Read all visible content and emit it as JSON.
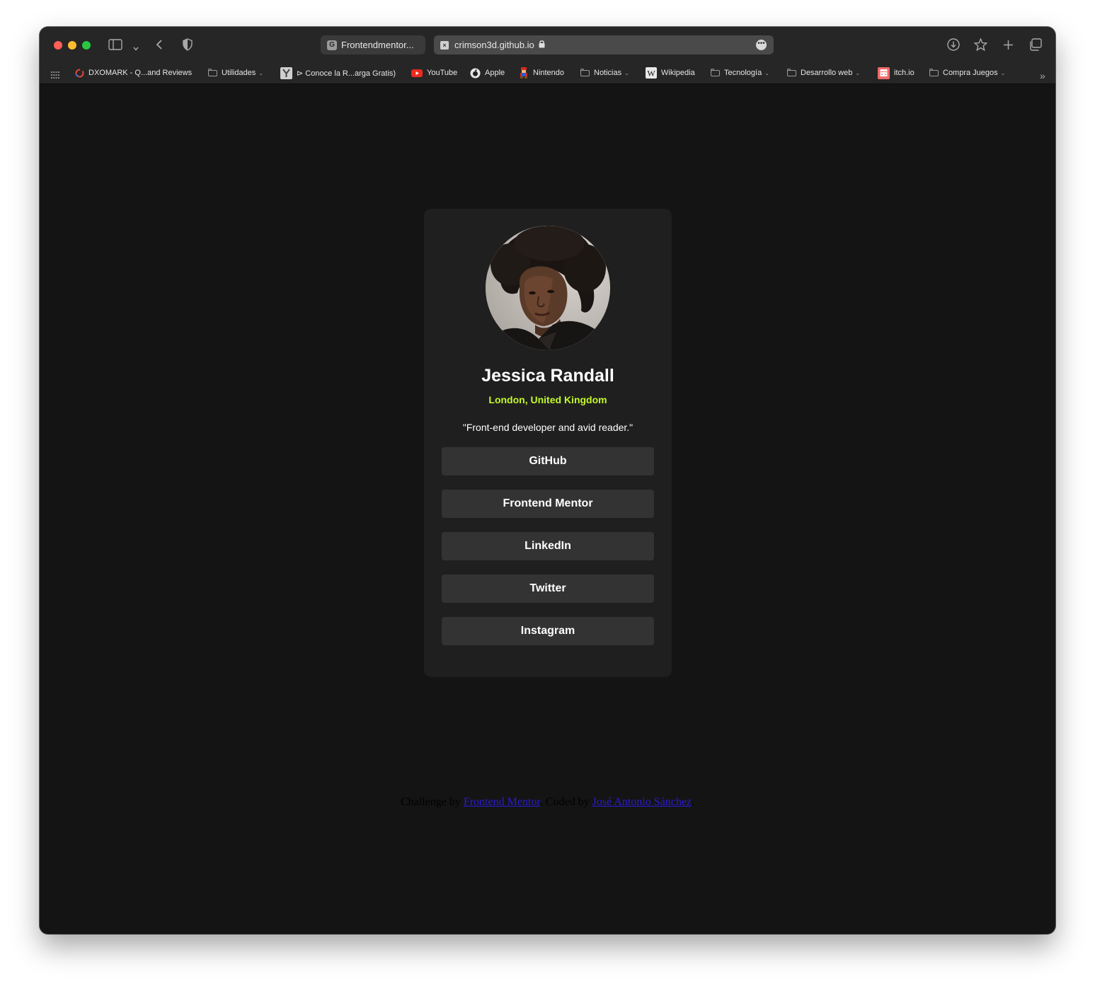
{
  "browser": {
    "tabs": [
      {
        "label": "Frontendmentor...",
        "favicon": "G"
      },
      {
        "label": "crimson3d.github.io"
      }
    ],
    "bookmarks": [
      {
        "label": "DXOMARK - Q...and Reviews",
        "icon": "dxomark-icon"
      },
      {
        "label": "Utilidades",
        "icon": "folder-icon",
        "folder": true
      },
      {
        "label": "⊳ Conoce la R...arga Gratis)",
        "icon": "bookmark-favicon-icon"
      },
      {
        "label": "YouTube",
        "icon": "youtube-icon"
      },
      {
        "label": "Apple",
        "icon": "apple-icon"
      },
      {
        "label": "Nintendo",
        "icon": "nintendo-icon"
      },
      {
        "label": "Noticias",
        "icon": "folder-icon",
        "folder": true
      },
      {
        "label": "Wikipedia",
        "icon": "wikipedia-icon"
      },
      {
        "label": "Tecnología",
        "icon": "folder-icon",
        "folder": true
      },
      {
        "label": "Desarrollo web",
        "icon": "folder-icon",
        "folder": true
      },
      {
        "label": "itch.io",
        "icon": "itchio-icon"
      },
      {
        "label": "Compra Juegos",
        "icon": "folder-icon",
        "folder": true
      }
    ]
  },
  "profile": {
    "name": "Jessica Randall",
    "location": "London, United Kingdom",
    "bio": "\"Front-end developer and avid reader.\"",
    "links": [
      "GitHub",
      "Frontend Mentor",
      "LinkedIn",
      "Twitter",
      "Instagram"
    ]
  },
  "footer": {
    "prefix": "Challenge by",
    "challenge_link": "Frontend Mentor",
    "middle": ". Coded by",
    "author_link": "José Antonio Sánchez",
    "suffix": "."
  },
  "colors": {
    "page_bg": "#141414",
    "card_bg": "#1f1f1f",
    "button_bg": "#333333",
    "accent_green": "#c4f82a",
    "link_blue": "#2b1bd4"
  }
}
